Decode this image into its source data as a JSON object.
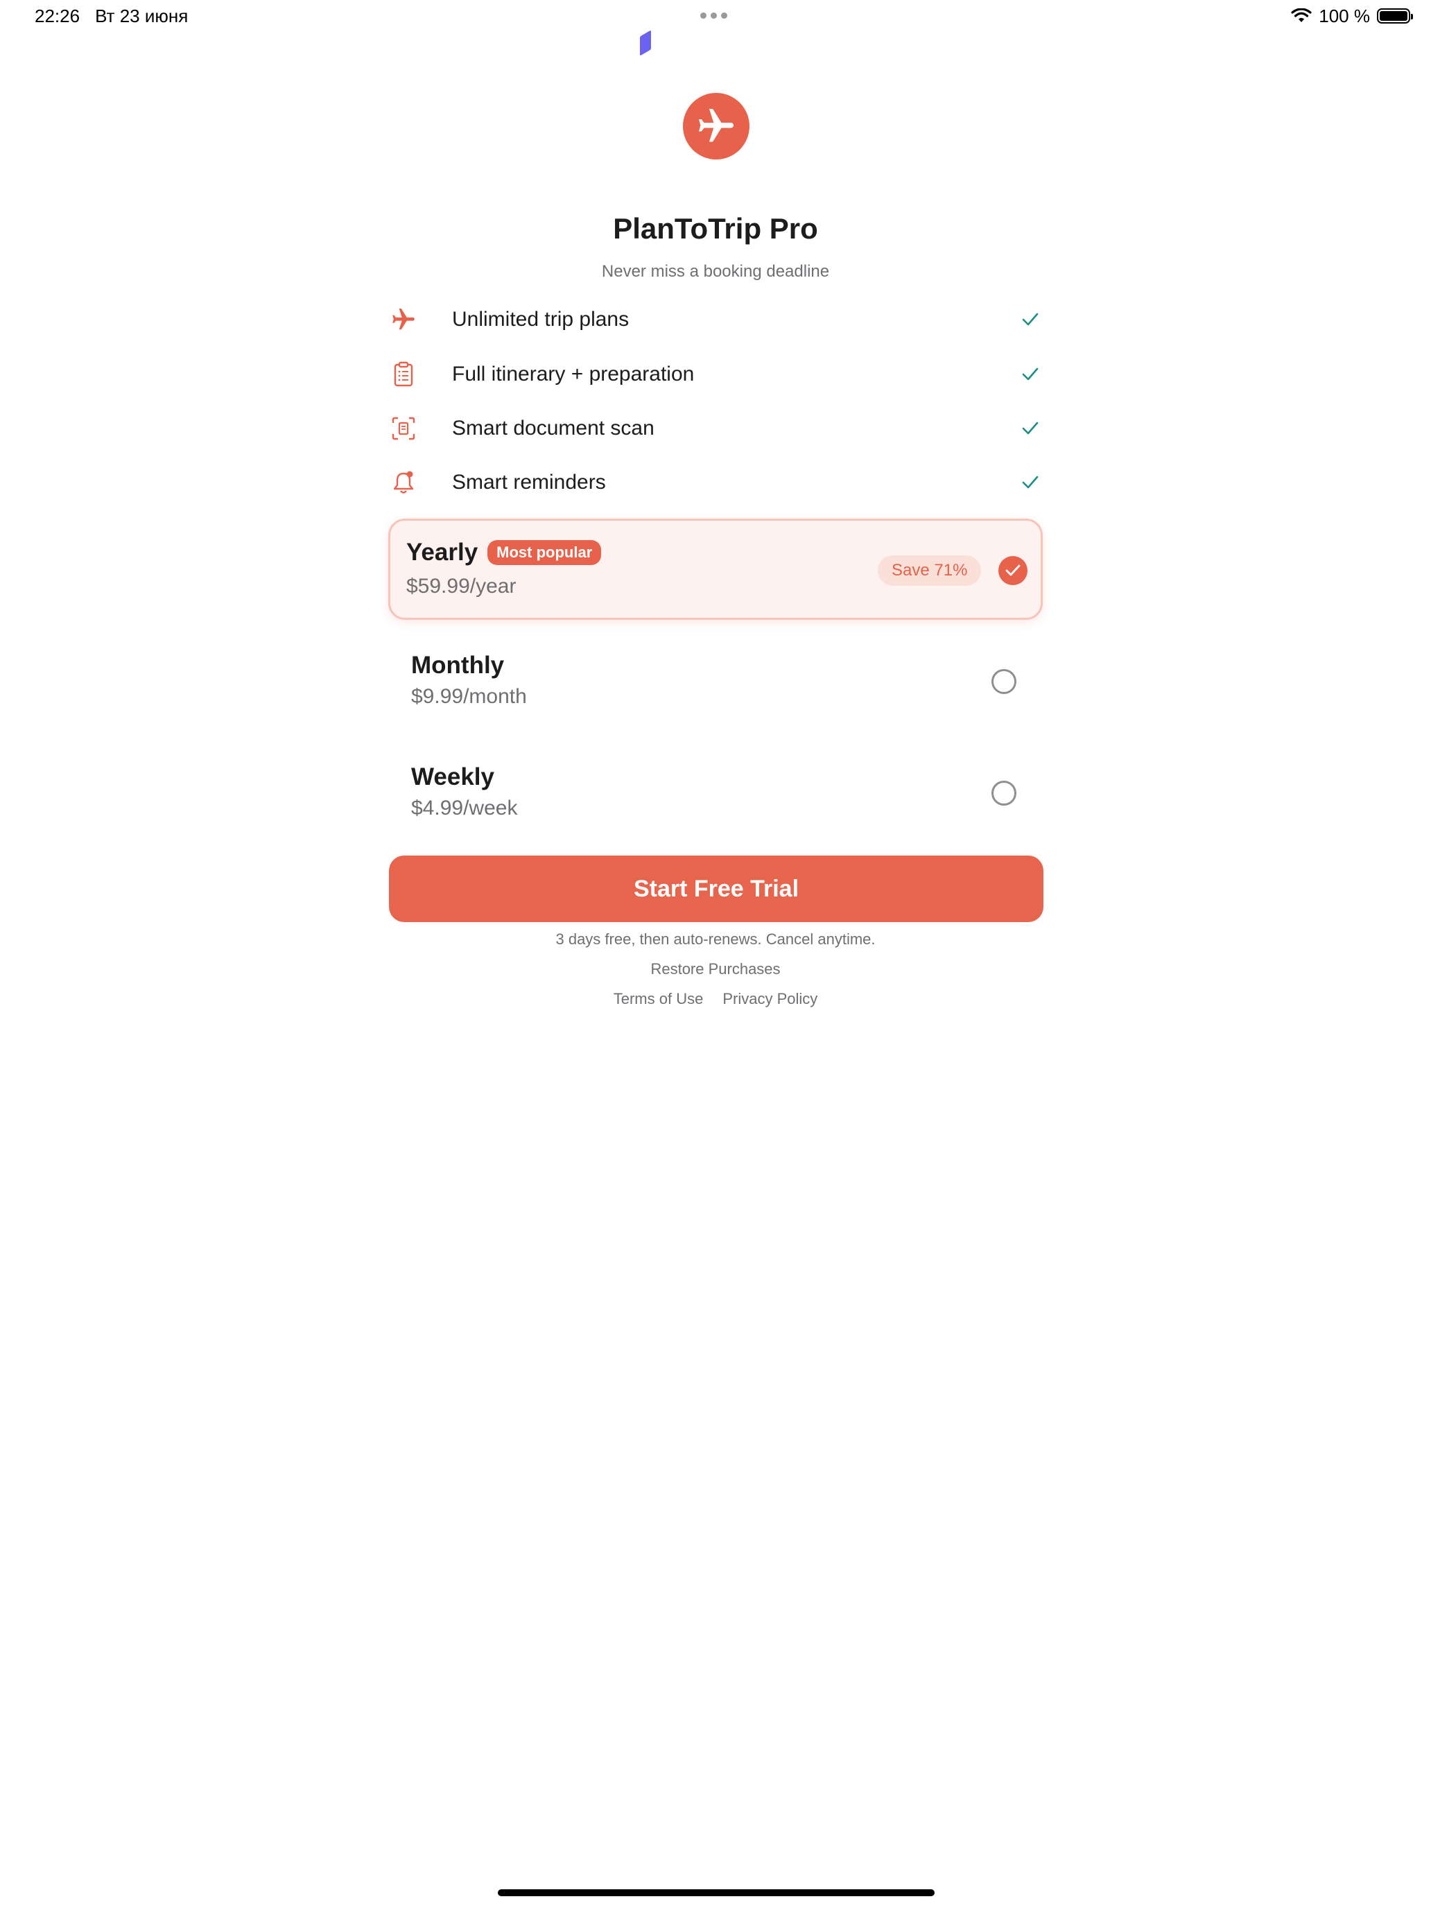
{
  "status_bar": {
    "time": "22:26",
    "date": "Вт 23 июня",
    "battery_text": "100 %",
    "wifi_icon": "wifi-icon",
    "battery_icon": "battery-icon"
  },
  "header": {
    "logo_icon": "airplane-icon",
    "title": "PlanToTrip Pro",
    "subtitle": "Never miss a booking deadline"
  },
  "features": [
    {
      "icon": "airplane-icon",
      "label": "Unlimited trip plans",
      "included": true
    },
    {
      "icon": "clipboard-icon",
      "label": "Full itinerary + preparation",
      "included": true
    },
    {
      "icon": "document-scan-icon",
      "label": "Smart document scan",
      "included": true
    },
    {
      "icon": "bell-icon",
      "label": "Smart reminders",
      "included": true
    }
  ],
  "plans": [
    {
      "name": "Yearly",
      "price": "$59.99/year",
      "badge": "Most popular",
      "save": "Save 71%",
      "selected": true
    },
    {
      "name": "Monthly",
      "price": "$9.99/month",
      "selected": false
    },
    {
      "name": "Weekly",
      "price": "$4.99/week",
      "selected": false
    }
  ],
  "cta": {
    "label": "Start Free Trial"
  },
  "footer": {
    "disclaimer": "3 days free, then auto-renews. Cancel anytime.",
    "restore": "Restore Purchases",
    "terms": "Terms of Use",
    "privacy": "Privacy Policy"
  },
  "colors": {
    "accent": "#e8614a",
    "check": "#1b8f86",
    "selected_bg": "#fdf2ef",
    "muted_text": "#6e6e73"
  }
}
